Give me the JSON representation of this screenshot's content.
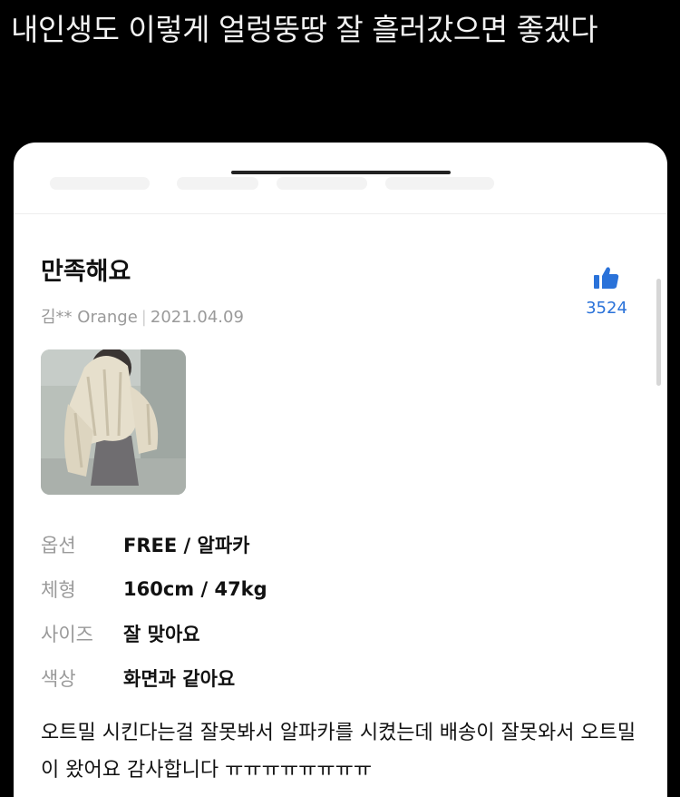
{
  "caption": "내인생도 이렇게 얼렁뚱땅 잘 흘러갔으면 좋겠다",
  "review": {
    "title": "만족해요",
    "author": "김** Orange",
    "date": "2021.04.09",
    "likes": "3524",
    "options": [
      {
        "key": "옵션",
        "value": "FREE / 알파카"
      },
      {
        "key": "체형",
        "value": "160cm / 47kg"
      },
      {
        "key": "사이즈",
        "value": "잘 맞아요"
      },
      {
        "key": "색상",
        "value": "화면과 같아요"
      }
    ],
    "body": "오트밀 시킨다는걸 잘못봐서 알파카를 시켰는데 배송이 잘못와서 오트밀이 왔어요 감사합니다 ㅠㅠㅠㅠㅠㅠㅠㅠ"
  },
  "colors": {
    "accent": "#2a72d9",
    "muted": "#9a9a9a"
  }
}
